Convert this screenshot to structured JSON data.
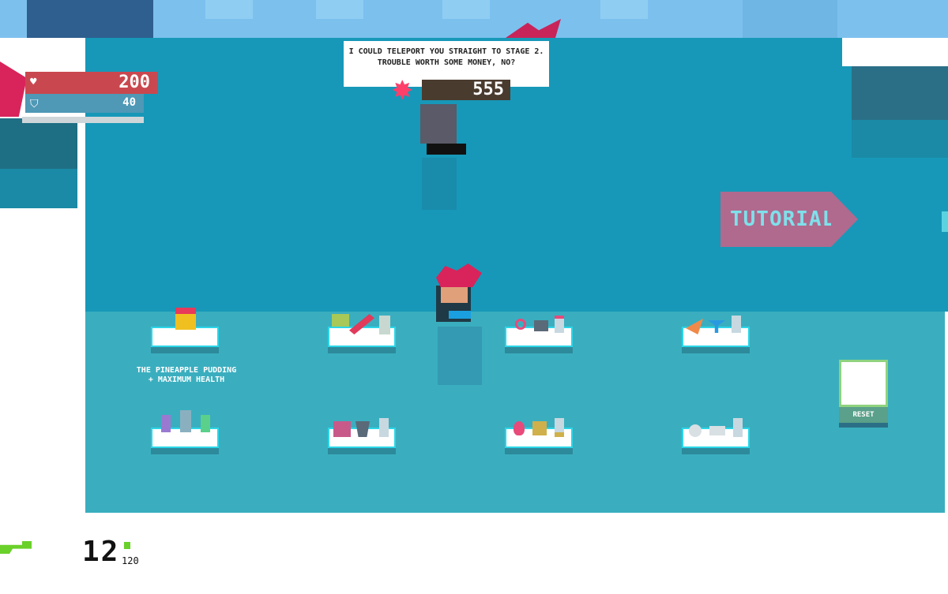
{
  "hud": {
    "health": "200",
    "shield": "40",
    "health_icon": "heart-icon",
    "shield_icon": "shield-icon"
  },
  "npc": {
    "dialog": "I COULD TELEPORT YOU STRAIGHT TO STAGE 2. TROUBLE WORTH SOME MONEY, NO?",
    "price": "555"
  },
  "sign": {
    "tutorial": "TUTORIAL"
  },
  "shop": {
    "selected_item_label_line1": "THE PINEAPPLE PUDDING",
    "selected_item_label_line2": "+ MAXIMUM HEALTH"
  },
  "reset": {
    "label": "RESET"
  },
  "weapon": {
    "ammo": "12",
    "ammo_max": "120",
    "icon": "gun-icon"
  },
  "colors": {
    "floor": "#1798b8",
    "lower_floor": "#3aaebf",
    "health": "#c9484f",
    "shield": "#4f98b6",
    "accent_pink": "#ff3f6a",
    "tutorial_sign": "#b06a8e"
  }
}
